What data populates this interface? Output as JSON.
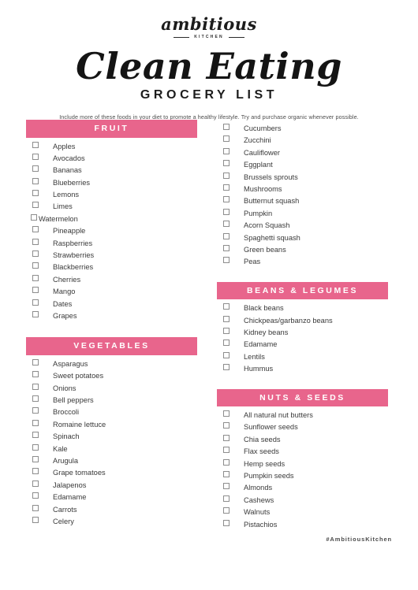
{
  "brand": {
    "script": "ambitious",
    "sub": "KITCHEN"
  },
  "header": {
    "title_script": "Clean Eating",
    "title_sub": "GROCERY LIST",
    "intro": "Include more of these foods in your diet to promote a healthy lifestyle. Try and purchase organic whenever possible."
  },
  "colors": {
    "accent": "#E8658C",
    "text": "#3A3A3A",
    "heading_text": "#FFFFFF",
    "checkbox_border": "#8D8D8D",
    "background": "#FFFFFF"
  },
  "left_column": {
    "sections": [
      {
        "title": "FRUIT",
        "items": [
          {
            "label": "Apples",
            "checked": false,
            "tight": false
          },
          {
            "label": "Avocados",
            "checked": false,
            "tight": false
          },
          {
            "label": "Bananas",
            "checked": false,
            "tight": false
          },
          {
            "label": "Blueberries",
            "checked": false,
            "tight": false
          },
          {
            "label": "Lemons",
            "checked": false,
            "tight": false
          },
          {
            "label": "Limes",
            "checked": false,
            "tight": false
          },
          {
            "label": "Watermelon",
            "checked": false,
            "tight": true
          },
          {
            "label": "Pineapple",
            "checked": false,
            "tight": false
          },
          {
            "label": "Raspberries",
            "checked": false,
            "tight": false
          },
          {
            "label": "Strawberries",
            "checked": false,
            "tight": false
          },
          {
            "label": "Blackberries",
            "checked": false,
            "tight": false
          },
          {
            "label": "Cherries",
            "checked": false,
            "tight": false
          },
          {
            "label": "Mango",
            "checked": false,
            "tight": false
          },
          {
            "label": "Dates",
            "checked": false,
            "tight": false
          },
          {
            "label": "Grapes",
            "checked": false,
            "tight": false
          }
        ]
      },
      {
        "title": "VEGETABLES",
        "items": [
          {
            "label": "Asparagus",
            "checked": false,
            "tight": false
          },
          {
            "label": "Sweet potatoes",
            "checked": false,
            "tight": false
          },
          {
            "label": "Onions",
            "checked": false,
            "tight": false
          },
          {
            "label": "Bell peppers",
            "checked": false,
            "tight": false
          },
          {
            "label": "Broccoli",
            "checked": false,
            "tight": false
          },
          {
            "label": "Romaine lettuce",
            "checked": false,
            "tight": false
          },
          {
            "label": "Spinach",
            "checked": false,
            "tight": false
          },
          {
            "label": "Kale",
            "checked": false,
            "tight": false
          },
          {
            "label": "Arugula",
            "checked": false,
            "tight": false
          },
          {
            "label": "Grape tomatoes",
            "checked": false,
            "tight": false
          },
          {
            "label": "Jalapenos",
            "checked": false,
            "tight": false
          },
          {
            "label": "Edamame",
            "checked": false,
            "tight": false
          },
          {
            "label": "Carrots",
            "checked": false,
            "tight": false
          },
          {
            "label": "Celery",
            "checked": false,
            "tight": false
          }
        ]
      }
    ]
  },
  "right_column": {
    "continued_items": [
      {
        "label": "Cucumbers",
        "checked": false,
        "tight": false
      },
      {
        "label": "Zucchini",
        "checked": false,
        "tight": false
      },
      {
        "label": "Cauliflower",
        "checked": false,
        "tight": false
      },
      {
        "label": "Eggplant",
        "checked": false,
        "tight": false
      },
      {
        "label": "Brussels sprouts",
        "checked": false,
        "tight": false
      },
      {
        "label": "Mushrooms",
        "checked": false,
        "tight": false
      },
      {
        "label": "Butternut squash",
        "checked": false,
        "tight": false
      },
      {
        "label": "Pumpkin",
        "checked": false,
        "tight": false
      },
      {
        "label": "Acorn Squash",
        "checked": false,
        "tight": false
      },
      {
        "label": "Spaghetti squash",
        "checked": false,
        "tight": false
      },
      {
        "label": "Green beans",
        "checked": false,
        "tight": false
      },
      {
        "label": "Peas",
        "checked": false,
        "tight": false
      }
    ],
    "sections": [
      {
        "title": "BEANS & LEGUMES",
        "items": [
          {
            "label": "Black beans",
            "checked": false,
            "tight": false
          },
          {
            "label": "Chickpeas/garbanzo beans",
            "checked": false,
            "tight": false
          },
          {
            "label": "Kidney beans",
            "checked": false,
            "tight": false
          },
          {
            "label": "Edamame",
            "checked": false,
            "tight": false
          },
          {
            "label": "Lentils",
            "checked": false,
            "tight": false
          },
          {
            "label": "Hummus",
            "checked": false,
            "tight": false
          }
        ]
      },
      {
        "title": "NUTS & SEEDS",
        "items": [
          {
            "label": "All natural nut butters",
            "checked": false,
            "tight": false
          },
          {
            "label": "Sunflower seeds",
            "checked": false,
            "tight": false
          },
          {
            "label": "Chia seeds",
            "checked": false,
            "tight": false
          },
          {
            "label": "Flax seeds",
            "checked": false,
            "tight": false
          },
          {
            "label": "Hemp seeds",
            "checked": false,
            "tight": false
          },
          {
            "label": "Pumpkin seeds",
            "checked": false,
            "tight": false
          },
          {
            "label": "Almonds",
            "checked": false,
            "tight": false
          },
          {
            "label": "Cashews",
            "checked": false,
            "tight": false
          },
          {
            "label": "Walnuts",
            "checked": false,
            "tight": false
          },
          {
            "label": "Pistachios",
            "checked": false,
            "tight": false
          }
        ]
      }
    ]
  },
  "footer": {
    "hashtag": "#AmbitiousKitchen"
  }
}
